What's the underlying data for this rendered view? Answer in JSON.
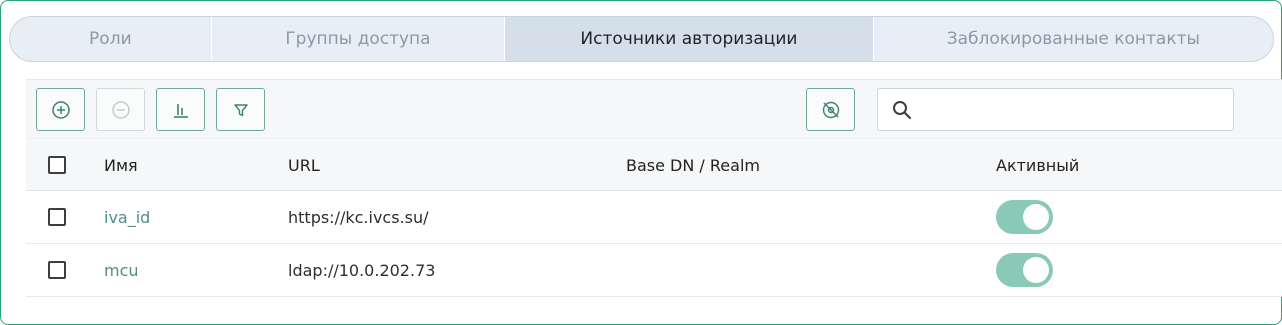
{
  "tabs": [
    {
      "label": "Роли",
      "active": false
    },
    {
      "label": "Группы доступа",
      "active": false
    },
    {
      "label": "Источники авторизации",
      "active": true
    },
    {
      "label": "Заблокированные контакты",
      "active": false
    }
  ],
  "toolbar": {
    "add": {
      "icon": "plus-circle-icon",
      "enabled": true
    },
    "remove": {
      "icon": "minus-circle-icon",
      "enabled": false
    },
    "columns": {
      "icon": "columns-icon",
      "enabled": true
    },
    "filter": {
      "icon": "filter-icon",
      "enabled": true
    },
    "hide_inactive": {
      "icon": "eye-off-icon",
      "enabled": true
    },
    "search": {
      "value": "",
      "placeholder": "",
      "icon": "search-icon"
    }
  },
  "table": {
    "headers": {
      "name": "Имя",
      "url": "URL",
      "base_dn": "Base DN / Realm",
      "active": "Активный"
    },
    "rows": [
      {
        "name": "iva_id",
        "url": "https://kc.ivcs.su/",
        "base_dn": "",
        "active": true,
        "selected": false
      },
      {
        "name": "mcu",
        "url": "ldap://10.0.202.73",
        "base_dn": "",
        "active": true,
        "selected": false
      }
    ]
  },
  "colors": {
    "accent": "#2aa57a",
    "link": "#4f8f8a",
    "toggle_on": "#8ac8b8",
    "tab_active_bg": "#d4dfea",
    "tab_bg": "#e8eef5"
  }
}
